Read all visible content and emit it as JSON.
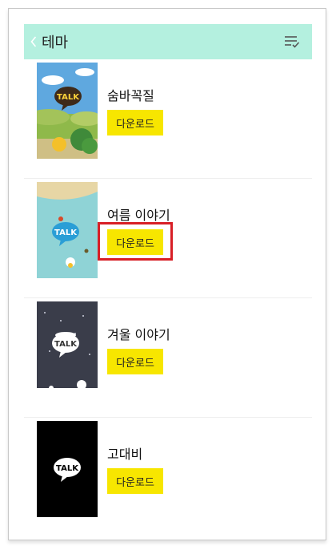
{
  "header": {
    "title": "테마",
    "bg_color": "#b4f0df"
  },
  "themes": [
    {
      "name": "숨바꼭질",
      "download_label": "다운로드",
      "thumb_text": "TALK"
    },
    {
      "name": "여름 이야기",
      "download_label": "다운로드",
      "thumb_text": "TALK"
    },
    {
      "name": "겨울 이야기",
      "download_label": "다운로드",
      "thumb_text": "TALK"
    },
    {
      "name": "고대비",
      "download_label": "다운로드",
      "thumb_text": "TALK"
    }
  ],
  "accent_button_color": "#f7e600",
  "highlight_color": "#d81f26"
}
